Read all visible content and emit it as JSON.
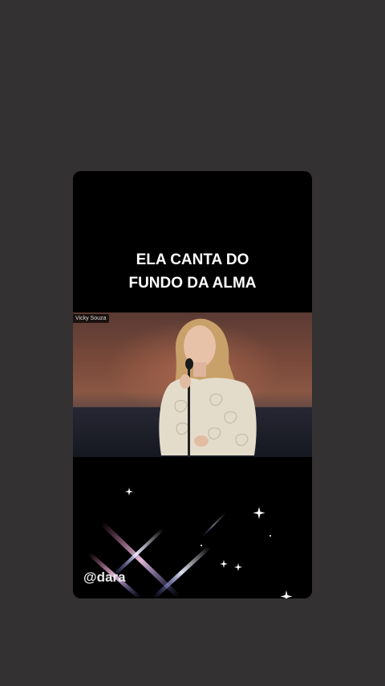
{
  "story": {
    "headline_line1": "ELA CANTA DO",
    "headline_line2": "FUNDO DA ALMA",
    "video_name_tag": "Vicky Souza",
    "handle": "@dara"
  },
  "icons": [
    "sparkle-icon"
  ],
  "colors": {
    "background": "#333132",
    "card": "#000000",
    "text": "#ffffff"
  }
}
